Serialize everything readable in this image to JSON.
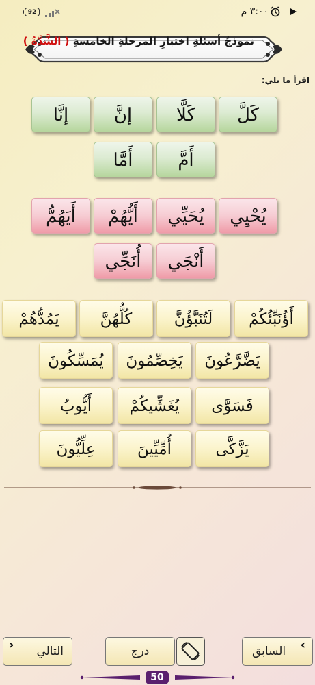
{
  "status_bar": {
    "battery": "92",
    "time": "٣:٠٠ م"
  },
  "header": {
    "title_main": "نموذجُ أسئلةِ اختبارِ المرحلةِ الخامسةِ",
    "title_highlight": "( الشَّدَّةُ )"
  },
  "instruction": "اقرأ ما يلي:",
  "group1": [
    {
      "word": "كَلَّ"
    },
    {
      "word": "كَلَّا"
    },
    {
      "word": "إنَّ"
    },
    {
      "word": "إنَّا"
    },
    {
      "word": "أَمَّ"
    },
    {
      "word": "أَمَّا"
    }
  ],
  "group2": [
    {
      "word": "يُحْيِي"
    },
    {
      "word": "يُحَيِّي"
    },
    {
      "word": "أَيُّهُمْ"
    },
    {
      "word": "أَيَهُمُّ"
    },
    {
      "word": "أَنْجَي"
    },
    {
      "word": "أُنَجِّي"
    }
  ],
  "group3": [
    {
      "word": "أَؤُنَبِّئُكُمْ"
    },
    {
      "word": "لَتُنَبَّؤُنَّ"
    },
    {
      "word": "كُلُّهُنَّ"
    },
    {
      "word": "يَمُدُّهُمْ"
    },
    {
      "word": "يَضَّرَّعُونَ"
    },
    {
      "word": "يَخِصِّمُونَ"
    },
    {
      "word": "يُمَسِّكُونَ"
    },
    {
      "word": "فَسَوَّى"
    },
    {
      "word": "يُغَشِّيكُمْ"
    },
    {
      "word": "أَيُّوبُ"
    },
    {
      "word": "يَزَّكَّى"
    },
    {
      "word": "أُمِّيِّينَ"
    },
    {
      "word": "عِلِّيُّونَ"
    }
  ],
  "footer": {
    "prev_label": "السابق",
    "index_label": "درج",
    "next_label": "التالي",
    "page_number": "50"
  },
  "colors": {
    "group1_tile": "#cfe6c2",
    "group2_tile": "#f4c3cb",
    "group3_tile": "#faf2c4",
    "title_red": "#d01010",
    "page_badge": "#5a1f6e"
  },
  "icons": [
    "wifi-off-icon",
    "alarm-icon",
    "play-icon",
    "rotate-screen-icon",
    "chevron-left-icon",
    "chevron-right-icon"
  ]
}
